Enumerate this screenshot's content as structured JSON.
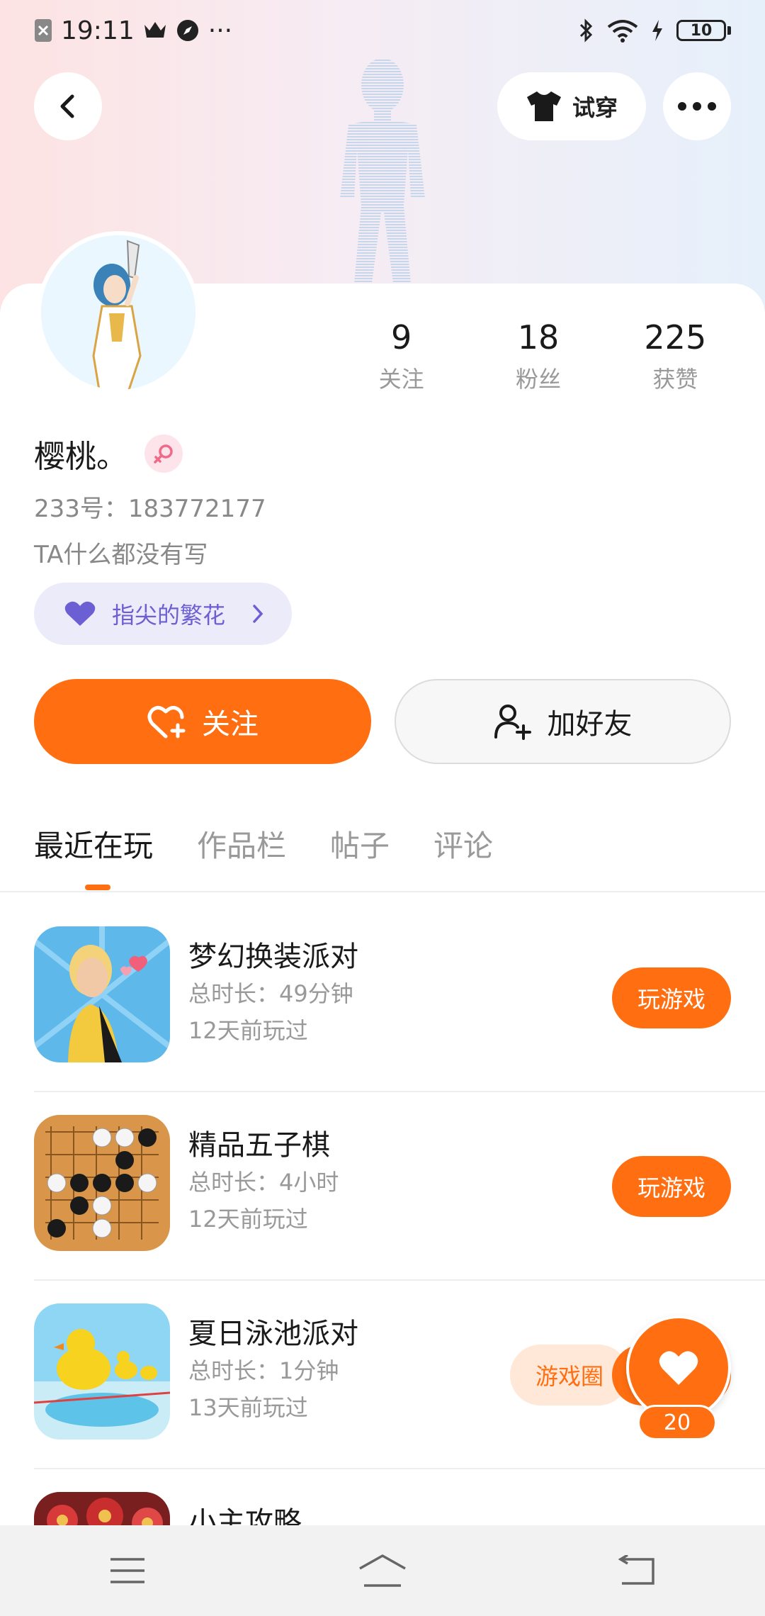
{
  "status_bar": {
    "time": "19:11",
    "more": "···",
    "battery": "10"
  },
  "top": {
    "tryon_label": "试穿"
  },
  "profile": {
    "stats": [
      {
        "value": "9",
        "label": "关注"
      },
      {
        "value": "18",
        "label": "粉丝"
      },
      {
        "value": "225",
        "label": "获赞"
      }
    ],
    "nickname": "樱桃。",
    "uid": "233号：183772177",
    "bio": "TA什么都没有写",
    "tag_label": "指尖的繁花"
  },
  "actions": {
    "follow_label": "关注",
    "add_friend_label": "加好友"
  },
  "tabs": [
    {
      "label": "最近在玩",
      "active": true
    },
    {
      "label": "作品栏",
      "active": false
    },
    {
      "label": "帖子",
      "active": false
    },
    {
      "label": "评论",
      "active": false
    }
  ],
  "games": [
    {
      "title": "梦幻换装派对",
      "duration": "总时长：49分钟",
      "last_played": "12天前玩过",
      "button": "玩游戏"
    },
    {
      "title": "精品五子棋",
      "duration": "总时长：4小时",
      "last_played": "12天前玩过",
      "button": "玩游戏"
    },
    {
      "title": "夏日泳池派对",
      "duration": "总时长：1分钟",
      "last_played": "13天前玩过",
      "circle_button": "游戏圈"
    },
    {
      "title": "小主攻略"
    }
  ],
  "fab": {
    "count": "20"
  },
  "colors": {
    "accent": "#ff6f12",
    "tag_text": "#6b5fd3"
  }
}
